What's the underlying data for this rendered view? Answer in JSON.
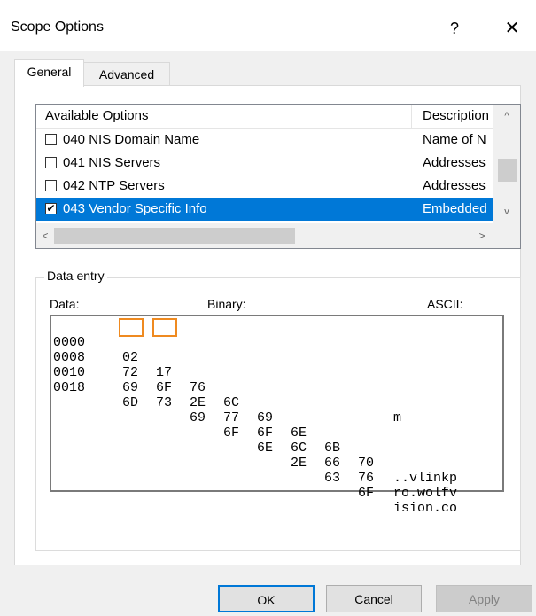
{
  "window": {
    "title": "Scope Options",
    "help_label": "?",
    "close_label": "✕"
  },
  "tabs": [
    {
      "label": "General",
      "active": true
    },
    {
      "label": "Advanced",
      "active": false
    }
  ],
  "options_list": {
    "headers": {
      "name": "Available Options",
      "description": "Description"
    },
    "scroll_up": "^",
    "scroll_down": "v",
    "scroll_left": "<",
    "scroll_right": ">",
    "rows": [
      {
        "checked": false,
        "name": "040 NIS Domain Name",
        "description": "Name of N"
      },
      {
        "checked": false,
        "name": "041 NIS Servers",
        "description": "Addresses"
      },
      {
        "checked": false,
        "name": "042 NTP Servers",
        "description": "Addresses"
      },
      {
        "checked": true,
        "selected": true,
        "name": "043 Vendor Specific Info",
        "description": "Embedded"
      }
    ]
  },
  "data_entry": {
    "label": "Data entry",
    "col_data": "Data:",
    "col_binary": "Binary:",
    "col_ascii": "ASCII:",
    "lines": [
      {
        "addr": "0000",
        "bytes": [
          "02",
          "17",
          "76",
          "6C",
          "69",
          "6E",
          "6B",
          "70"
        ],
        "ascii": "..vlinkp"
      },
      {
        "addr": "0008",
        "bytes": [
          "72",
          "6F",
          "2E",
          "77",
          "6F",
          "6C",
          "66",
          "76"
        ],
        "ascii": "ro.wolfv"
      },
      {
        "addr": "0010",
        "bytes": [
          "69",
          "73",
          "69",
          "6F",
          "6E",
          "2E",
          "63",
          "6F"
        ],
        "ascii": "ision.co"
      },
      {
        "addr": "0018",
        "bytes": [
          "6D"
        ],
        "ascii": "m"
      }
    ],
    "highlighted_bytes": [
      "02",
      "17"
    ],
    "highlight_color": "#ef8a20"
  },
  "buttons": {
    "ok": "OK",
    "cancel": "Cancel",
    "apply": "Apply"
  },
  "colors": {
    "selection": "#0078d7"
  }
}
